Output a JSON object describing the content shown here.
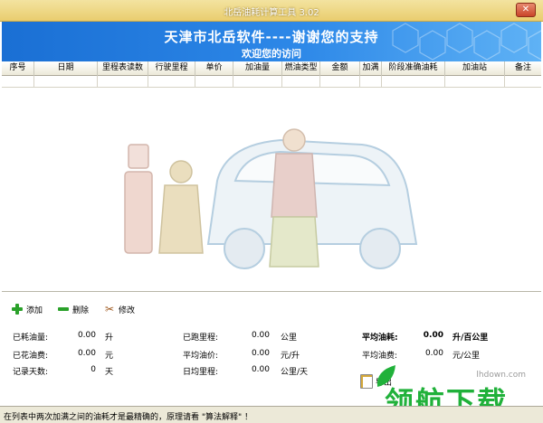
{
  "window": {
    "title": "北岳油耗计算工具 3.02",
    "close_label": "✕"
  },
  "banner": {
    "main": "天津市北岳软件----谢谢您的支持",
    "sub": "欢迎您的访问"
  },
  "columns": [
    "序号",
    "日期",
    "里程表读数",
    "行驶里程",
    "单价",
    "加油量",
    "燃油类型",
    "金额",
    "加满",
    "阶段准确油耗",
    "加油站",
    "备注"
  ],
  "toolbar": {
    "add": "添加",
    "delete": "删除",
    "edit": "修改"
  },
  "stats": {
    "fuel_used": {
      "label": "已耗油量:",
      "value": "0.00",
      "unit": "升"
    },
    "fuel_cost": {
      "label": "已花油费:",
      "value": "0.00",
      "unit": "元"
    },
    "record_days": {
      "label": "记录天数:",
      "value": "0",
      "unit": "天"
    },
    "mileage": {
      "label": "已跑里程:",
      "value": "0.00",
      "unit": "公里"
    },
    "avg_price": {
      "label": "平均油价:",
      "value": "0.00",
      "unit": "元/升"
    },
    "daily_mileage": {
      "label": "日均里程:",
      "value": "0.00",
      "unit": "公里/天"
    },
    "avg_consumption": {
      "label": "平均油耗:",
      "value": "0.00",
      "unit": "升/百公里"
    },
    "avg_cost": {
      "label": "平均油费:",
      "value": "0.00",
      "unit": "元/公里"
    }
  },
  "export_label": "导出",
  "watermark": {
    "brand": "领航下载",
    "url": "lhdown.com"
  },
  "status_text": "在列表中两次加满之间的油耗才是最精确的，原理请看 \"算法解释\" ！",
  "colors": {
    "banner": "#1a6fd4",
    "titlebar": "#e9cd6e",
    "brand_green": "#20b13a"
  }
}
